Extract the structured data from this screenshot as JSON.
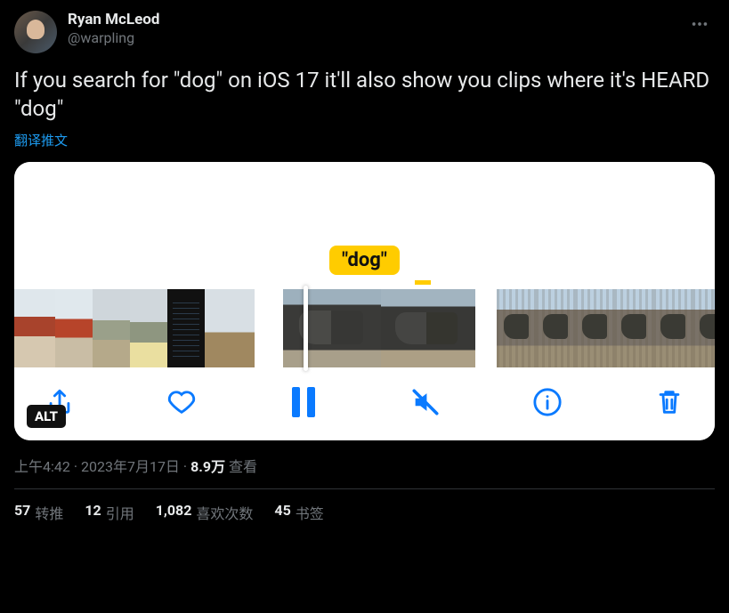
{
  "author": {
    "display_name": "Ryan McLeod",
    "handle": "@warpling"
  },
  "tweet_text": "If you search for \"dog\" on iOS 17 it'll also show you clips where it's HEARD \"dog\"",
  "translate_label": "翻译推文",
  "media": {
    "highlight_word": "\"dog\"",
    "alt_badge": "ALT"
  },
  "meta": {
    "time": "上午4:42",
    "sep1": " · ",
    "date": "2023年7月17日",
    "sep2": " · ",
    "views_num": "8.9万",
    "views_label": " 查看"
  },
  "stats": {
    "retweets_num": "57",
    "retweets_label": "转推",
    "quotes_num": "12",
    "quotes_label": "引用",
    "likes_num": "1,082",
    "likes_label": "喜欢次数",
    "bookmarks_num": "45",
    "bookmarks_label": "书签"
  }
}
